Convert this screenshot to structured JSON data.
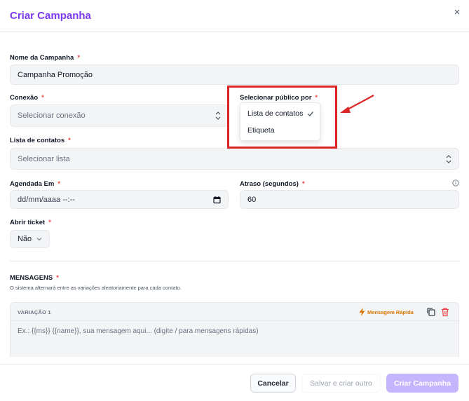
{
  "dialog": {
    "title": "Criar Campanha",
    "close_glyph": "×"
  },
  "form": {
    "required_mark": "*",
    "campaign_name": {
      "label": "Nome da Campanha",
      "value": "Campanha Promoção"
    },
    "connection": {
      "label": "Conexão",
      "placeholder": "Selecionar conexão"
    },
    "audience": {
      "label": "Selecionar público por",
      "options": [
        "Lista de contatos",
        "Etiqueta"
      ],
      "selected": "Lista de contatos"
    },
    "contact_list": {
      "label": "Lista de contatos",
      "placeholder": "Selecionar lista"
    },
    "scheduled_at": {
      "label": "Agendada Em",
      "placeholder": "dd/mm/aaaa  --:--"
    },
    "delay": {
      "label": "Atraso (segundos)",
      "value": "60"
    },
    "open_ticket": {
      "label": "Abrir ticket",
      "value": "Não"
    }
  },
  "messages": {
    "heading": "MENSAGENS",
    "description": "O sistema alternará entre as variações aleatoriamente para cada contato.",
    "variation": {
      "title": "VARIAÇÃO 1",
      "quick_message_label": "Mensagem Rápida",
      "placeholder": "Ex.: {{ms}} {{name}}, sua mensagem aqui... (digite / para mensagens rápidas)"
    }
  },
  "footer": {
    "cancel_label": "Cancelar",
    "save_create_other_label": "Salvar e criar outro",
    "create_label": "Criar Campanha"
  },
  "colors": {
    "brand": "#7c3aed",
    "brand_disabled": "#c4b5fd",
    "required": "#ef4444",
    "quick_message": "#d97706",
    "highlight": "#dc2626"
  },
  "icons": [
    "close-icon",
    "updown-chevron-icon",
    "info-icon",
    "calendar-icon",
    "chevron-down-icon",
    "lightning-icon",
    "copy-icon",
    "trash-icon",
    "check-icon",
    "arrow-annotation"
  ]
}
